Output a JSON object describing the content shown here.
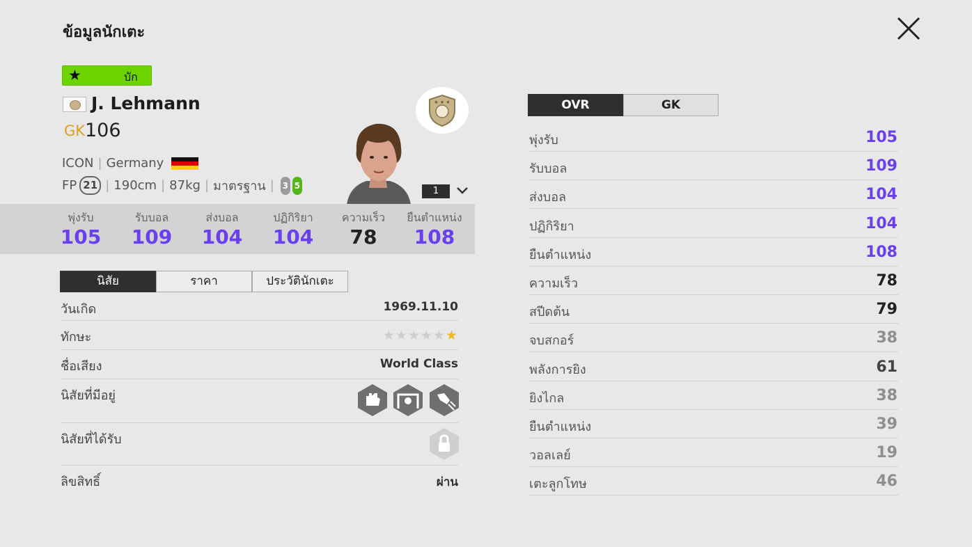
{
  "page": {
    "title": "ข้อมูลนักเตะ",
    "close_label": "close"
  },
  "player": {
    "badge_label": "บัก",
    "name": "J. Lehmann",
    "position": "GK",
    "ovr": "106",
    "league": "ICON",
    "nation": "Germany",
    "fp_label": "FP",
    "fp_value": "21",
    "height": "190cm",
    "weight": "87kg",
    "body_type": "มาตรฐาน",
    "weak_foot": "3",
    "strong_foot": "5",
    "upgrade_level": "1"
  },
  "summary_stats": [
    {
      "label": "พุ่งรับ",
      "value": "105",
      "color": "#6a3ff0"
    },
    {
      "label": "รับบอล",
      "value": "109",
      "color": "#6a3ff0"
    },
    {
      "label": "ส่งบอล",
      "value": "104",
      "color": "#6a3ff0"
    },
    {
      "label": "ปฏิกิริยา",
      "value": "104",
      "color": "#6a3ff0"
    },
    {
      "label": "ความเร็ว",
      "value": "78",
      "color": "#222222"
    },
    {
      "label": "ยืนตำแหน่ง",
      "value": "108",
      "color": "#6a3ff0"
    }
  ],
  "tabs": [
    {
      "label": "นิสัย",
      "active": true
    },
    {
      "label": "ราคา",
      "active": false
    },
    {
      "label": "ประวัตินักเตะ",
      "active": false
    }
  ],
  "info": {
    "birthday_label": "วันเกิด",
    "birthday": "1969.11.10",
    "skill_label": "ทักษะ",
    "skill_stars": 1,
    "skill_stars_max": 5,
    "reputation_label": "ชื่อเสียง",
    "reputation": "World Class",
    "traits_owned_label": "นิสัยที่มีอยู่",
    "traits_owned_icons": [
      "gk-hands-icon",
      "gk-goal-icon",
      "gk-punch-icon"
    ],
    "traits_earned_label": "นิสัยที่ได้รับ",
    "traits_earned_icon": "lock-icon",
    "license_label": "ลิขสิทธิ์",
    "license": "ผ่าน"
  },
  "right_tabs": [
    {
      "label": "OVR",
      "active": true
    },
    {
      "label": "GK",
      "active": false
    }
  ],
  "detail_stats": [
    {
      "label": "พุ่งรับ",
      "value": "105",
      "color": "#6a3ff0"
    },
    {
      "label": "รับบอล",
      "value": "109",
      "color": "#6a3ff0"
    },
    {
      "label": "ส่งบอล",
      "value": "104",
      "color": "#6a3ff0"
    },
    {
      "label": "ปฏิกิริยา",
      "value": "104",
      "color": "#6a3ff0"
    },
    {
      "label": "ยืนตำแหน่ง",
      "value": "108",
      "color": "#6a3ff0"
    },
    {
      "label": "ความเร็ว",
      "value": "78",
      "color": "#222222"
    },
    {
      "label": "สปีดต้น",
      "value": "79",
      "color": "#222222"
    },
    {
      "label": "จบสกอร์",
      "value": "38",
      "color": "#8e8e8e"
    },
    {
      "label": "พลังการยิง",
      "value": "61",
      "color": "#444444"
    },
    {
      "label": "ยิงไกล",
      "value": "38",
      "color": "#8e8e8e"
    },
    {
      "label": "ยืนตำแหน่ง",
      "value": "39",
      "color": "#8e8e8e"
    },
    {
      "label": "วอลเลย์",
      "value": "19",
      "color": "#8e8e8e"
    },
    {
      "label": "เตะลูกโทษ",
      "value": "46",
      "color": "#8e8e8e"
    }
  ]
}
